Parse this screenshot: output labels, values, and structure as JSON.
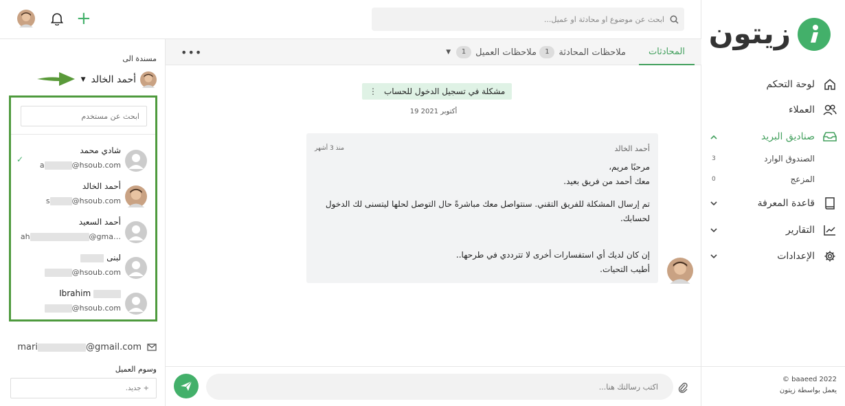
{
  "app": {
    "brand_logo_text": "زيتون",
    "accent": "#43b06a",
    "highlight_border": "#4e9a3d"
  },
  "search": {
    "placeholder": "ابحث عن موضوع او محادثة او عميل..."
  },
  "topbar": {
    "plus_label": "+"
  },
  "sidebar": {
    "items": [
      {
        "label": "لوحة التحكم",
        "icon": "home-icon"
      },
      {
        "label": "العملاء",
        "icon": "users-icon"
      },
      {
        "label": "صناديق البريد",
        "icon": "inbox-icon",
        "expanded": true
      },
      {
        "label": "قاعدة المعرفة",
        "icon": "book-icon"
      },
      {
        "label": "التقارير",
        "icon": "chart-icon"
      },
      {
        "label": "الإعدادات",
        "icon": "gear-icon"
      }
    ],
    "mailboxes": [
      {
        "label": "الصندوق الوارد",
        "count": "3"
      },
      {
        "label": "المزعج",
        "count": "0"
      }
    ],
    "copyright_line1": "baaeed 2022 ©",
    "copyright_line2": "يعمل بواسطة زيتون"
  },
  "tabs": {
    "conversations": "المحادثات",
    "conversation_notes": "ملاحظات المحادثة",
    "conversation_notes_count": "1",
    "client_notes": "ملاحظات العميل",
    "client_notes_count": "1",
    "more": "•••"
  },
  "conversation": {
    "subject": "مشكلة في تسجيل الدخول للحساب",
    "date": "19 أكتوبر 2021",
    "message": {
      "author": "أحمد الخالد",
      "time": "منذ 3 أشهر",
      "line1": "مرحبًا مريم،",
      "line2": "معك أحمد من فريق بعيد.",
      "line3": "تم إرسال المشكلة للفريق التقني. سنتواصل معك مباشرةً حال التوصل لحلها ليتسنى لك الدخول لحسابك.",
      "line4": "إن كان لديك أي استفسارات أخرى لا تترددي في طرحها..",
      "line5": "أطيب التحيات."
    },
    "composer_placeholder": "اكتب رسالتك هنا..."
  },
  "left_panel": {
    "assigned_label": "مسندة الى",
    "assignee": "أحمد الخالد",
    "user_search_placeholder": "ابحث عن مستخدم",
    "users": [
      {
        "name": "شادي محمد",
        "email_start": "a",
        "email_end": "@hsoub.com",
        "selected": true,
        "photo": false
      },
      {
        "name": "أحمد الخالد",
        "email_start": "s",
        "email_end": "@hsoub.com",
        "selected": false,
        "photo": true
      },
      {
        "name": "أحمد السعيد",
        "email_start": "ah",
        "email_end": "@gma…",
        "selected": false,
        "photo": false
      },
      {
        "name": "لبنى",
        "email_start": "",
        "email_end": "@hsoub.com",
        "selected": false,
        "photo": false
      },
      {
        "name": "Ibrahim",
        "email_start": "",
        "email_end": "@hsoub.com",
        "selected": false,
        "photo": false
      }
    ],
    "client_email_start": "mari",
    "client_email_end": "@gmail.com",
    "client_tags_label": "وسوم العميل",
    "new_tag_placeholder": "+ جديد."
  }
}
